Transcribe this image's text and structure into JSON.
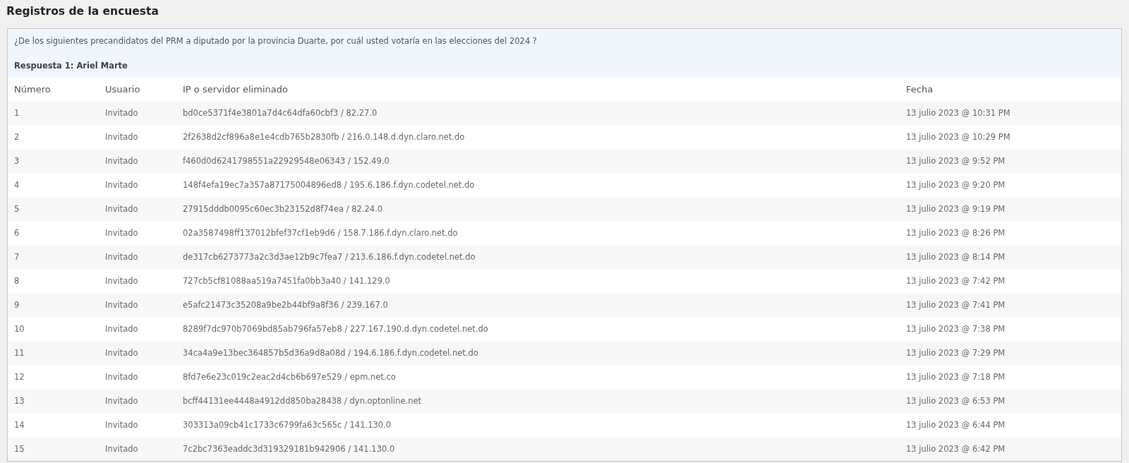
{
  "title": "Registros de la encuesta",
  "question": "¿De los siguientes precandidatos del PRM a diputado por la provincia Duarte, por cuál usted votaría en las elecciones del 2024 ?",
  "answer": "Respuesta 1: Ariel Marte",
  "table": {
    "columns": [
      "Número",
      "Usuario",
      "IP o servidor eliminado",
      "Fecha"
    ],
    "rows": [
      [
        "1",
        "Invitado",
        "bd0ce5371f4e3801a7d4c64dfa60cbf3 / 82.27.0",
        "13 julio 2023 @ 10:31 PM"
      ],
      [
        "2",
        "Invitado",
        "2f2638d2cf896a8e1e4cdb765b2830fb / 216.0.148.d.dyn.claro.net.do",
        "13 julio 2023 @ 10:29 PM"
      ],
      [
        "3",
        "Invitado",
        "f460d0d6241798551a22929548e06343 / 152.49.0",
        "13 julio 2023 @ 9:52 PM"
      ],
      [
        "4",
        "Invitado",
        "148f4efa19ec7a357a87175004896ed8 / 195.6.186.f.dyn.codetel.net.do",
        "13 julio 2023 @ 9:20 PM"
      ],
      [
        "5",
        "Invitado",
        "27915dddb0095c60ec3b23152d8f74ea / 82.24.0",
        "13 julio 2023 @ 9:19 PM"
      ],
      [
        "6",
        "Invitado",
        "02a3587498ff137012bfef37cf1eb9d6 / 158.7.186.f.dyn.claro.net.do",
        "13 julio 2023 @ 8:26 PM"
      ],
      [
        "7",
        "Invitado",
        "de317cb6273773a2c3d3ae12b9c7fea7 / 213.6.186.f.dyn.codetel.net.do",
        "13 julio 2023 @ 8:14 PM"
      ],
      [
        "8",
        "Invitado",
        "727cb5cf81088aa519a7451fa0bb3a40 / 141.129.0",
        "13 julio 2023 @ 7:42 PM"
      ],
      [
        "9",
        "Invitado",
        "e5afc21473c35208a9be2b44bf9a8f36 / 239.167.0",
        "13 julio 2023 @ 7:41 PM"
      ],
      [
        "10",
        "Invitado",
        "8289f7dc970b7069bd85ab796fa57eb8 / 227.167.190.d.dyn.codetel.net.do",
        "13 julio 2023 @ 7:38 PM"
      ],
      [
        "11",
        "Invitado",
        "34ca4a9e13bec364857b5d36a9d8a08d / 194.6.186.f.dyn.codetel.net.do",
        "13 julio 2023 @ 7:29 PM"
      ],
      [
        "12",
        "Invitado",
        "8fd7e6e23c019c2eac2d4cb6b697e529 / epm.net.co",
        "13 julio 2023 @ 7:18 PM"
      ],
      [
        "13",
        "Invitado",
        "bcff44131ee4448a4912dd850ba28438 / dyn.optonline.net",
        "13 julio 2023 @ 6:53 PM"
      ],
      [
        "14",
        "Invitado",
        "303313a09cb41c1733c6799fa63c565c / 141.130.0",
        "13 julio 2023 @ 6:44 PM"
      ],
      [
        "15",
        "Invitado",
        "7c2bc7363eaddc3d319329181b942906 / 141.130.0",
        "13 julio 2023 @ 6:42 PM"
      ]
    ]
  }
}
